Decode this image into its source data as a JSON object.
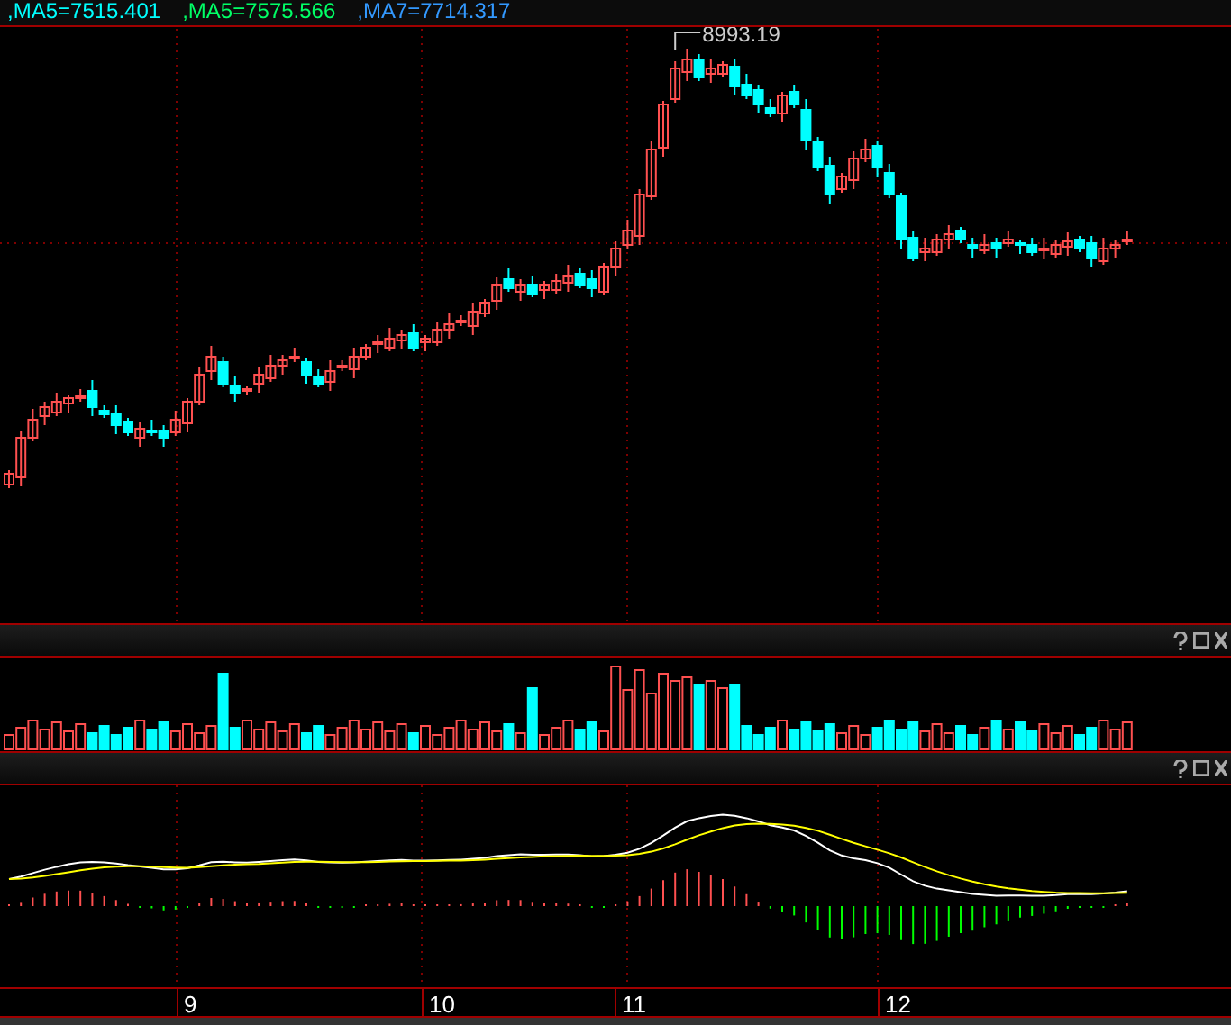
{
  "legend": [
    {
      "text": ",MA5=7515.401",
      "color": "#00ffff"
    },
    {
      "text": ",MA5=7575.566",
      "color": "#00ff66"
    },
    {
      "text": ",MA7=7714.317",
      "color": "#3399ff"
    }
  ],
  "price_chart": {
    "high_label": "8993.19"
  },
  "panels": [
    {
      "kind": "volume"
    },
    {
      "kind": "macd"
    }
  ],
  "x_axis": {
    "labels": [
      "9",
      "10",
      "11",
      "12"
    ]
  }
}
